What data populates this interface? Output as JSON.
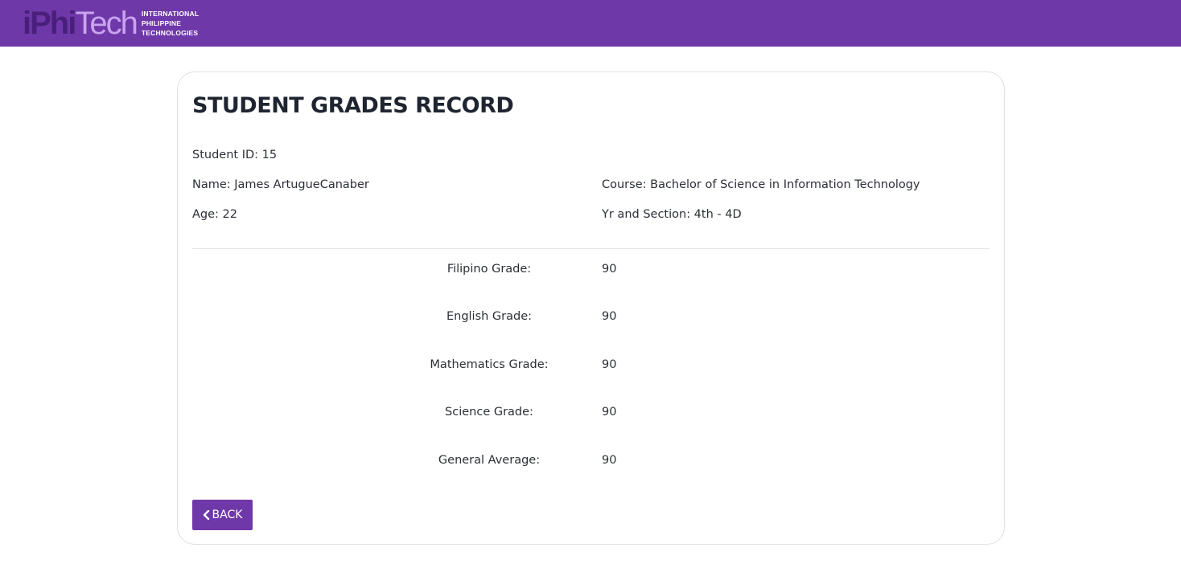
{
  "brand": {
    "logo_text_a": "iPhi",
    "logo_text_b": "Tech",
    "sub_lines": [
      "INTERNATIONAL",
      "PHILIPPINE",
      "TECHNOLOGIES"
    ],
    "nav_color": "#6f38a8"
  },
  "record": {
    "title": "STUDENT GRADES RECORD",
    "student_id": "Student ID: 15",
    "name": "Name: James ArtugueCanaber",
    "age": "Age: 22",
    "course": "Course: Bachelor of Science in Information Technology",
    "yr_section": "Yr and Section: 4th - 4D"
  },
  "grades": [
    {
      "label": "Filipino Grade:",
      "value": "90"
    },
    {
      "label": "English Grade:",
      "value": "90"
    },
    {
      "label": "Mathematics Grade:",
      "value": "90"
    },
    {
      "label": "Science Grade:",
      "value": "90"
    },
    {
      "label": "General Average:",
      "value": "90"
    }
  ],
  "actions": {
    "back_label": "BACK",
    "back_icon": "chevron-left-icon"
  }
}
